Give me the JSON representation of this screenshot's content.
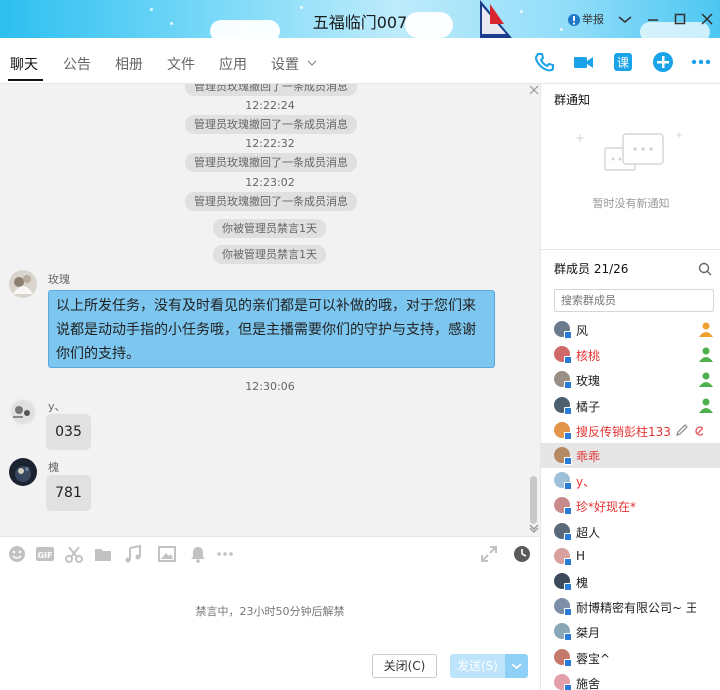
{
  "window": {
    "title": "五福临门007",
    "report_label": "举报"
  },
  "tabs": [
    {
      "label": "聊天",
      "active": true
    },
    {
      "label": "公告"
    },
    {
      "label": "相册"
    },
    {
      "label": "文件"
    },
    {
      "label": "应用"
    },
    {
      "label": "设置"
    }
  ],
  "messages": {
    "sys_top_partial": "管理员玫瑰撤回了一条成员消息",
    "system": [
      {
        "time": "12:22:24",
        "text": "管理员玫瑰撤回了一条成员消息"
      },
      {
        "time": "12:22:32",
        "text": "管理员玫瑰撤回了一条成员消息"
      },
      {
        "time": "12:23:02",
        "text": "管理员玫瑰撤回了一条成员消息"
      }
    ],
    "mute_notices": [
      "你被管理员禁言1天",
      "你被管理员禁言1天"
    ],
    "msg1": {
      "sender": "玫瑰",
      "line1": "以上所发任务，没有及时看见的亲们都是可以补做的哦，对于您们来",
      "line2": "说都是动动手指的小任务哦，但是主播需要你们的守护与支持，感谢",
      "line3": "你们的支持。"
    },
    "time2": "12:30:06",
    "msg2": {
      "sender": "y、",
      "text": "035"
    },
    "msg3": {
      "sender": "槐",
      "text": "781"
    }
  },
  "input": {
    "mute_status": "禁言中，23小时50分钟后解禁",
    "close_label": "关闭(C)",
    "send_label": "发送(S)"
  },
  "group": {
    "notice_title": "群通知",
    "notice_empty": "暂时没有新通知",
    "members_title": "群成员 21/26",
    "search_placeholder": "搜索群成员",
    "members": [
      {
        "name": "风",
        "color": "#222"
      },
      {
        "name": "核桃",
        "color": "#e53333"
      },
      {
        "name": "玫瑰",
        "color": "#222"
      },
      {
        "name": "橘子",
        "color": "#222"
      },
      {
        "name": "搜反传销彭柱133",
        "color": "#e53333"
      },
      {
        "name": "乖乖",
        "color": "#e53333"
      },
      {
        "name": "y、",
        "color": "#e53333"
      },
      {
        "name": "珍*好现在*",
        "color": "#e53333"
      },
      {
        "name": "超人",
        "color": "#222"
      },
      {
        "name": "H",
        "color": "#222"
      },
      {
        "name": "槐",
        "color": "#222"
      },
      {
        "name": "耐博精密有限公司~ 王露",
        "color": "#222"
      },
      {
        "name": "桀月",
        "color": "#222"
      },
      {
        "name": "蓉宝^",
        "color": "#222"
      },
      {
        "name": "施舍",
        "color": "#222"
      }
    ]
  },
  "colors": {
    "accent": "#1aa3e8",
    "selection": "#7cc6ef",
    "name_red": "#e53333"
  }
}
